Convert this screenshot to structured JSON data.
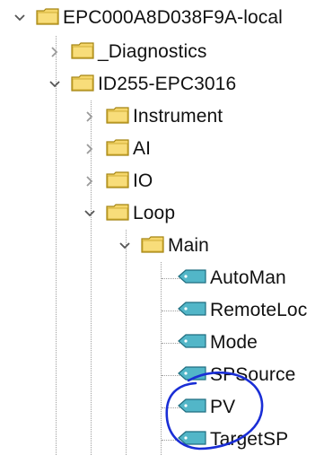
{
  "tree": {
    "nodes": [
      {
        "id": "root",
        "label": "EPC000A8D038F9A-local",
        "type": "folder",
        "state": "expanded"
      },
      {
        "id": "diagnostics",
        "label": "_Diagnostics",
        "type": "folder",
        "state": "collapsed"
      },
      {
        "id": "id255",
        "label": "ID255-EPC3016",
        "type": "folder",
        "state": "expanded"
      },
      {
        "id": "instrument",
        "label": "Instrument",
        "type": "folder",
        "state": "collapsed"
      },
      {
        "id": "ai",
        "label": "AI",
        "type": "folder",
        "state": "collapsed"
      },
      {
        "id": "io",
        "label": "IO",
        "type": "folder",
        "state": "collapsed"
      },
      {
        "id": "loop",
        "label": "Loop",
        "type": "folder",
        "state": "expanded"
      },
      {
        "id": "main",
        "label": "Main",
        "type": "folder",
        "state": "expanded"
      },
      {
        "id": "automan",
        "label": "AutoMan",
        "type": "tag"
      },
      {
        "id": "remoteloc",
        "label": "RemoteLoc",
        "type": "tag"
      },
      {
        "id": "mode",
        "label": "Mode",
        "type": "tag"
      },
      {
        "id": "spsource",
        "label": "SPSource",
        "type": "tag"
      },
      {
        "id": "pv",
        "label": "PV",
        "type": "tag"
      },
      {
        "id": "targetsp",
        "label": "TargetSP",
        "type": "tag"
      }
    ]
  },
  "annotation": {
    "color": "#1a2ed6"
  },
  "colors": {
    "folder_fill": "#f5d66b",
    "folder_stroke": "#a58512",
    "tag_fill": "#52b6c8",
    "tag_stroke": "#1f6e80",
    "chevron": "#555555",
    "chevron_collapsed": "#9a9a9a"
  },
  "icons": {
    "folder": "folder-icon",
    "tag": "tag-icon",
    "expanded": "chevron-down-icon",
    "collapsed": "chevron-right-icon"
  }
}
